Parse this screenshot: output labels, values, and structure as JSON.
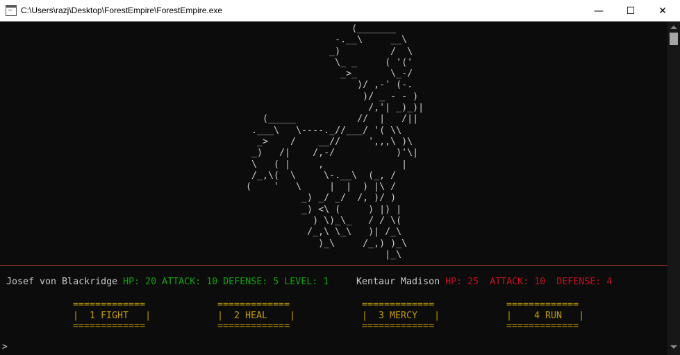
{
  "window": {
    "title": "C:\\Users\\razj\\Desktop\\ForestEmpire\\ForestEmpire.exe",
    "minimize_glyph": "—",
    "maximize_glyph": "☐",
    "close_glyph": "✕"
  },
  "ascii_art": "                   (_______\n                -.__\\     __\\\n               _)         /  \\\n                \\_ _     ( '('\n                 _>_      \\_-/\n                    )/ ,-' (-.\n                     )/ _ - - )\n                      /,'| _)_)|\n   (_____           //  |   /||\n .___\\   \\----._//___/ '( \\\\\n  _>    /    __//     ',,,\\ )\\\n _)   /|    /,-/           )'\\|\n \\   ( |     ,              |\n /_,\\(  \\     \\-.__\\  (_, /\n(    '   \\     |  |  ) |\\ /\n          _) _/ _/  /, )/ )\n          _) <\\ (     ) |) |\n            ) \\)_\\_   / / \\(\n           /_,\\ \\_\\   )| /_\\\n             )_\\     /_,) )_\\\n                         |_\\",
  "player": {
    "name": "Josef von Blackridge",
    "stats": "HP: 20 ATTACK: 10 DEFENSE: 5 LEVEL: 1"
  },
  "enemy": {
    "name": "Kentaur Madison",
    "stats": "HP: 25  ATTACK: 10  DEFENSE: 4"
  },
  "menu": [
    {
      "text": "=============\n|  1 FIGHT   |\n============="
    },
    {
      "text": "=============\n|  2 HEAL    |\n============="
    },
    {
      "text": "=============\n|  3 MERCY   |\n============="
    },
    {
      "text": "=============\n|    4 RUN   |\n============="
    }
  ],
  "prompt": ">",
  "colors": {
    "player_stats": "#13a10e",
    "enemy_stats": "#c50f1f",
    "menu": "#c19c00",
    "divider": "#c0392b",
    "text": "#cccccc"
  }
}
